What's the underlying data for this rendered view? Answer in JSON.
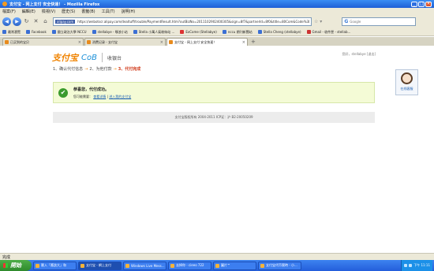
{
  "window": {
    "title": "支付宝 - 网上支付 安全快速！ - Mozilla Firefox",
    "min": "_",
    "max": "□",
    "close": "✕"
  },
  "menu": [
    "檔案(F)",
    "編輯(E)",
    "檢視(V)",
    "歷史(S)",
    "書籤(B)",
    "工具(T)",
    "說明(H)"
  ],
  "nav": {
    "back": "◀",
    "forward": "▶",
    "reload": "↻",
    "stop": "✕",
    "home": "⌂",
    "site_label": "alipay.com",
    "url": "https://wnbotscr.alipay.com/dealtuff/trouble/PaymentResult.htm?outBizNo=2011102902400305&sign=8f7&partnerId=8f0&title=80Com&Code%3DE",
    "stars": "☆ ▾",
    "search_engine": "G",
    "search_placeholder": "Google"
  },
  "bookmarks": [
    "最常瀏覽",
    "Facebook",
    "國立政治大學 NCCU",
    "stellabye - 噗浪小站",
    "Stella 小萬人氣粉絲站 ...",
    "ExCome (Stellabye)",
    "nccu 期刊新聞站",
    "Stella Cheng (stellabye)",
    "Gmail - 收件匣 - stellab..."
  ],
  "tabs": [
    {
      "label": "已买到的宝贝",
      "active": false
    },
    {
      "label": "消费记录 - 支付宝",
      "active": false
    },
    {
      "label": "支付宝 - 网上支付 安全快速！",
      "active": true
    }
  ],
  "tab_new": "+",
  "page": {
    "logo": "支付宝",
    "logo_sub": "CoB",
    "cashier": "收银台",
    "header_right": "您好，stellabye [退出]",
    "steps": {
      "s1": "1、确认代付信息",
      "arr1": "→",
      "s2": "2、为他付款",
      "arr2": "→",
      "s3": "3、代付完成"
    },
    "success": {
      "title": "恭喜您，代付成功。",
      "prefix": "您可能需要：",
      "link1": "查看详情",
      "sep": "|",
      "link2": "进入我的支付宝"
    },
    "footer": "支付宝版权所有 2004-2011 ICP证：沪 B2-20050209",
    "csr_label": "在线客服"
  },
  "status": "完成",
  "taskbar": {
    "start": "開始",
    "buttons": [
      {
        "label": "匯入「應該大」和",
        "active": false
      },
      {
        "label": "支付宝 - 網上支付",
        "active": true
      },
      {
        "label": "Windows Live Mess...",
        "active": false
      },
      {
        "label": "去掉你 - cieeo 722",
        "active": false
      },
      {
        "label": "圖片™",
        "active": false
      },
      {
        "label": "支付宝代币實時 - 小...",
        "active": false
      }
    ],
    "clock": "下午 11:11"
  },
  "colors": {
    "brand": "#f08300",
    "success_bg": "#f4fbd6",
    "link": "#1a5fb4"
  }
}
